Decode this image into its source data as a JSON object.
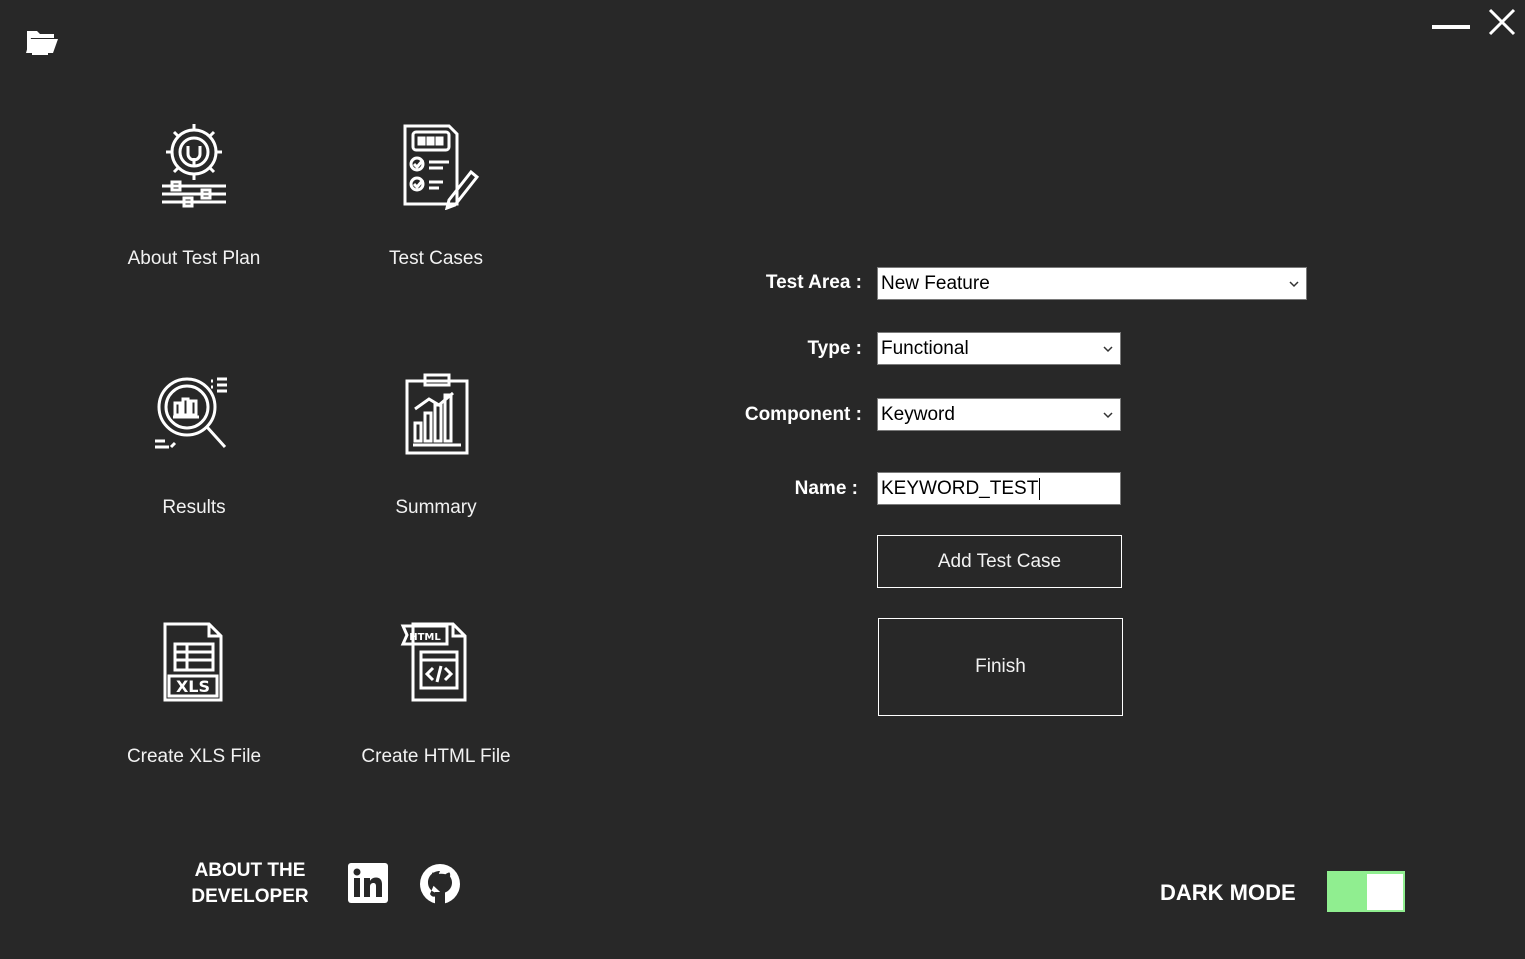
{
  "window": {
    "folder_icon": "folder-open-icon",
    "minimize_icon": "minimize-icon",
    "close_icon": "close-icon"
  },
  "tiles": [
    {
      "label": "About Test Plan",
      "icon": "settings-gear-sliders-icon"
    },
    {
      "label": "Test Cases",
      "icon": "checklist-document-pen-icon"
    },
    {
      "label": "Results",
      "icon": "magnifier-chart-icon"
    },
    {
      "label": "Summary",
      "icon": "clipboard-bar-chart-icon"
    },
    {
      "label": "Create XLS File",
      "icon": "xls-file-icon"
    },
    {
      "label": "Create HTML File",
      "icon": "html-file-icon"
    }
  ],
  "form": {
    "test_area_label": "Test Area :",
    "test_area_value": "New Feature",
    "type_label": "Type :",
    "type_value": "Functional",
    "component_label": "Component :",
    "component_value": "Keyword",
    "name_label": "Name :",
    "name_value": "KEYWORD_TEST",
    "add_button": "Add Test Case",
    "finish_button": "Finish"
  },
  "footer": {
    "about_line1": "ABOUT THE",
    "about_line2": "DEVELOPER",
    "linkedin_icon": "linkedin-icon",
    "github_icon": "github-icon",
    "dark_mode_label": "DARK MODE",
    "dark_mode_on": true,
    "toggle_color": "#90ee90"
  },
  "colors": {
    "background": "#282828",
    "foreground": "#ffffff",
    "accent": "#90ee90"
  }
}
